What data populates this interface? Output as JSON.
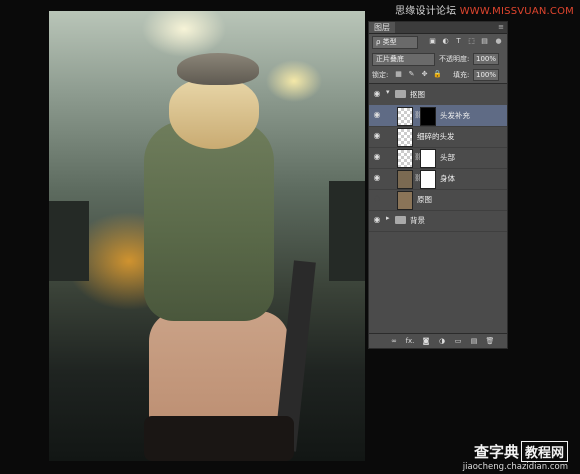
{
  "watermark_top": {
    "prefix": "思缘设计论坛 ",
    "accent": "WWW.MISSVUAN.COM"
  },
  "canvas": {},
  "layers_panel": {
    "tab_label": "图层",
    "filter": {
      "kind_label": "ρ 类型",
      "icons": [
        "▣",
        "◐",
        "T",
        "⬚",
        "▤"
      ]
    },
    "blend": {
      "mode": "正片叠底",
      "opacity_label": "不透明度:",
      "opacity_value": "100%"
    },
    "lock": {
      "label": "锁定:",
      "icons": [
        "▦",
        "✎",
        "✥",
        "🔒"
      ],
      "fill_label": "填充:",
      "fill_value": "100%"
    },
    "layers": [
      {
        "name": "抠图",
        "type": "group",
        "expanded": true,
        "visible": true
      },
      {
        "name": "头发补充",
        "type": "layer",
        "visible": true,
        "selected": true,
        "mask": "black"
      },
      {
        "name": "细碎的头发",
        "type": "layer",
        "visible": true,
        "selected": false,
        "mask": null
      },
      {
        "name": "头部",
        "type": "layer",
        "visible": true,
        "selected": false,
        "mask": "white"
      },
      {
        "name": "身体",
        "type": "layer",
        "visible": true,
        "selected": false,
        "mask": "white"
      },
      {
        "name": "原图",
        "type": "layer",
        "visible": false,
        "selected": false,
        "mask": null
      },
      {
        "name": "背景",
        "type": "group",
        "expanded": false,
        "visible": true
      }
    ],
    "bottom_icons": [
      "∞",
      "fx.",
      "◙",
      "◑",
      "▭",
      "▤",
      "🗑"
    ]
  },
  "watermark_bottom": {
    "line1_a": "查字典",
    "line1_b": "教程网",
    "line2": "jiaocheng.chazidian.com"
  },
  "colors": {
    "selected_layer": "#5f6b85",
    "panel_bg": "#535353",
    "accent_red": "#e0452e"
  }
}
